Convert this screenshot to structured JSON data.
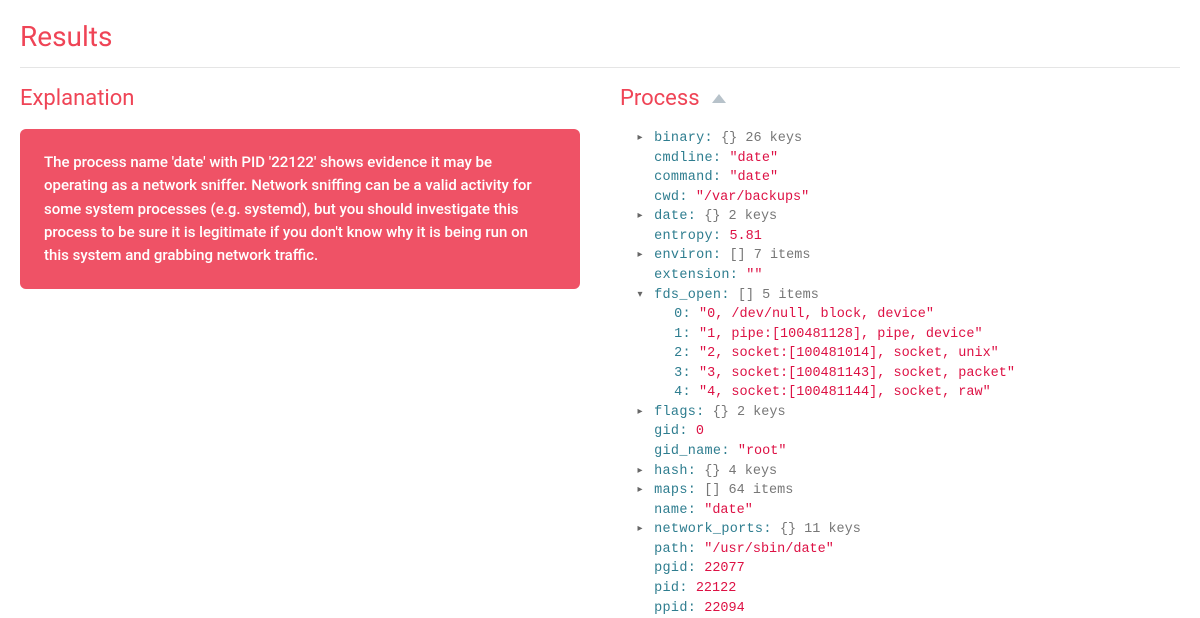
{
  "title": "Results",
  "explanation": {
    "heading": "Explanation",
    "body": "The process name 'date' with PID '22122' shows evidence it may be operating as a network sniffer. Network sniffing can be a valid activity for some system processes (e.g. systemd), but you should investigate this process to be sure it is legitimate if you don't know why it is being run on this system and grabbing network traffic."
  },
  "process": {
    "heading": "Process",
    "rows": [
      {
        "tw": "▸",
        "depth": 1,
        "key": "binary",
        "brace": "{}",
        "meta": "26 keys"
      },
      {
        "tw": "",
        "depth": 1,
        "key": "cmdline",
        "val": "\"date\"",
        "vtype": "str"
      },
      {
        "tw": "",
        "depth": 1,
        "key": "command",
        "val": "\"date\"",
        "vtype": "str"
      },
      {
        "tw": "",
        "depth": 1,
        "key": "cwd",
        "val": "\"/var/backups\"",
        "vtype": "str"
      },
      {
        "tw": "▸",
        "depth": 1,
        "key": "date",
        "brace": "{}",
        "meta": "2 keys"
      },
      {
        "tw": "",
        "depth": 1,
        "key": "entropy",
        "val": "5.81",
        "vtype": "num"
      },
      {
        "tw": "▸",
        "depth": 1,
        "key": "environ",
        "brace": "[]",
        "meta": "7 items"
      },
      {
        "tw": "",
        "depth": 1,
        "key": "extension",
        "val": "\"\"",
        "vtype": "str"
      },
      {
        "tw": "▾",
        "depth": 1,
        "key": "fds_open",
        "brace": "[]",
        "meta": "5 items"
      },
      {
        "tw": "",
        "depth": 2,
        "key": "0",
        "val": "\"0, /dev/null, block, device\"",
        "vtype": "str"
      },
      {
        "tw": "",
        "depth": 2,
        "key": "1",
        "val": "\"1, pipe:[100481128], pipe, device\"",
        "vtype": "str"
      },
      {
        "tw": "",
        "depth": 2,
        "key": "2",
        "val": "\"2, socket:[100481014], socket, unix\"",
        "vtype": "str"
      },
      {
        "tw": "",
        "depth": 2,
        "key": "3",
        "val": "\"3, socket:[100481143], socket, packet\"",
        "vtype": "str"
      },
      {
        "tw": "",
        "depth": 2,
        "key": "4",
        "val": "\"4, socket:[100481144], socket, raw\"",
        "vtype": "str"
      },
      {
        "tw": "▸",
        "depth": 1,
        "key": "flags",
        "brace": "{}",
        "meta": "2 keys"
      },
      {
        "tw": "",
        "depth": 1,
        "key": "gid",
        "val": "0",
        "vtype": "num"
      },
      {
        "tw": "",
        "depth": 1,
        "key": "gid_name",
        "val": "\"root\"",
        "vtype": "str"
      },
      {
        "tw": "▸",
        "depth": 1,
        "key": "hash",
        "brace": "{}",
        "meta": "4 keys"
      },
      {
        "tw": "▸",
        "depth": 1,
        "key": "maps",
        "brace": "[]",
        "meta": "64 items"
      },
      {
        "tw": "",
        "depth": 1,
        "key": "name",
        "val": "\"date\"",
        "vtype": "str"
      },
      {
        "tw": "▸",
        "depth": 1,
        "key": "network_ports",
        "brace": "{}",
        "meta": "11 keys"
      },
      {
        "tw": "",
        "depth": 1,
        "key": "path",
        "val": "\"/usr/sbin/date\"",
        "vtype": "str"
      },
      {
        "tw": "",
        "depth": 1,
        "key": "pgid",
        "val": "22077",
        "vtype": "num"
      },
      {
        "tw": "",
        "depth": 1,
        "key": "pid",
        "val": "22122",
        "vtype": "num"
      },
      {
        "tw": "",
        "depth": 1,
        "key": "ppid",
        "val": "22094",
        "vtype": "num"
      }
    ]
  }
}
